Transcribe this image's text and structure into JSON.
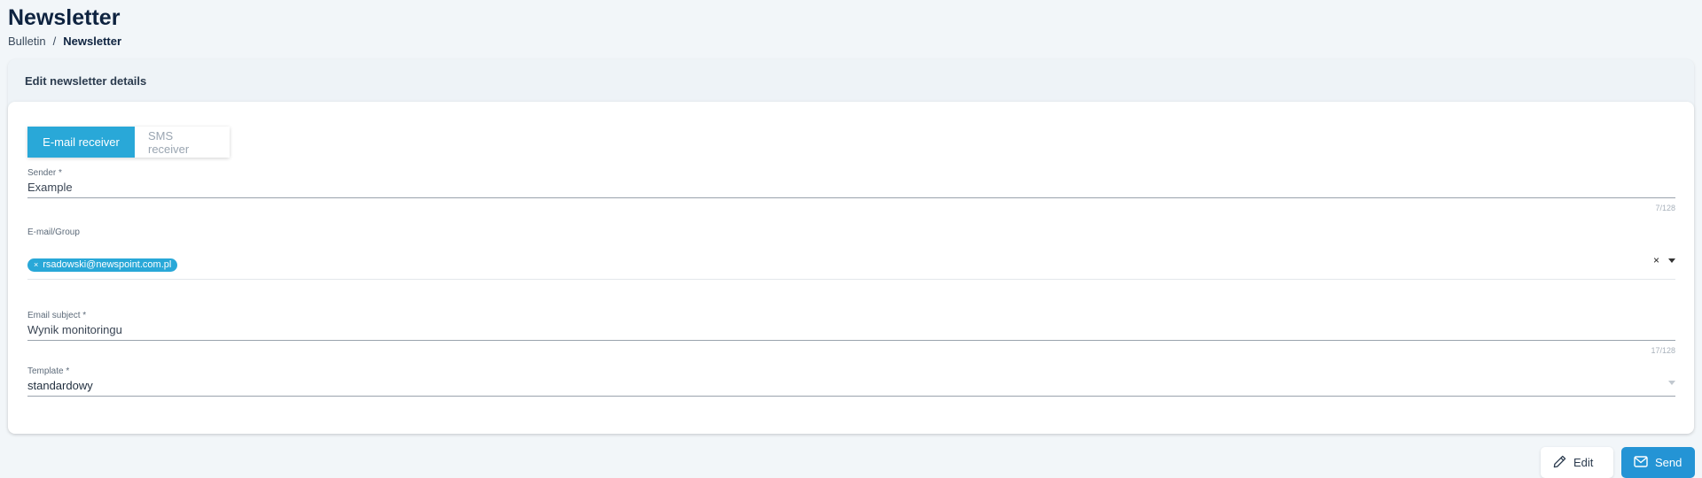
{
  "page": {
    "title": "Newsletter",
    "breadcrumb": {
      "parent": "Bulletin",
      "separator": "/",
      "current": "Newsletter"
    }
  },
  "card": {
    "header": "Edit newsletter details",
    "tabs": [
      {
        "label": "E-mail receiver",
        "active": true
      },
      {
        "label": "SMS receiver",
        "active": false
      }
    ],
    "fields": {
      "sender": {
        "label": "Sender *",
        "value": "Example",
        "counter": "7/128"
      },
      "email_group": {
        "label": "E-mail/Group",
        "chips": [
          "rsadowski@newspoint.com.pl"
        ],
        "clear_icon": "×"
      },
      "subject": {
        "label": "Email subject *",
        "value": "Wynik monitoringu",
        "counter": "17/128"
      },
      "template": {
        "label": "Template *",
        "value": "standardowy"
      }
    }
  },
  "actions": {
    "edit_label": "Edit",
    "send_label": "Send"
  },
  "colors": {
    "accent": "#29a8d8",
    "send_button": "#2494d5",
    "title": "#0e2340"
  }
}
